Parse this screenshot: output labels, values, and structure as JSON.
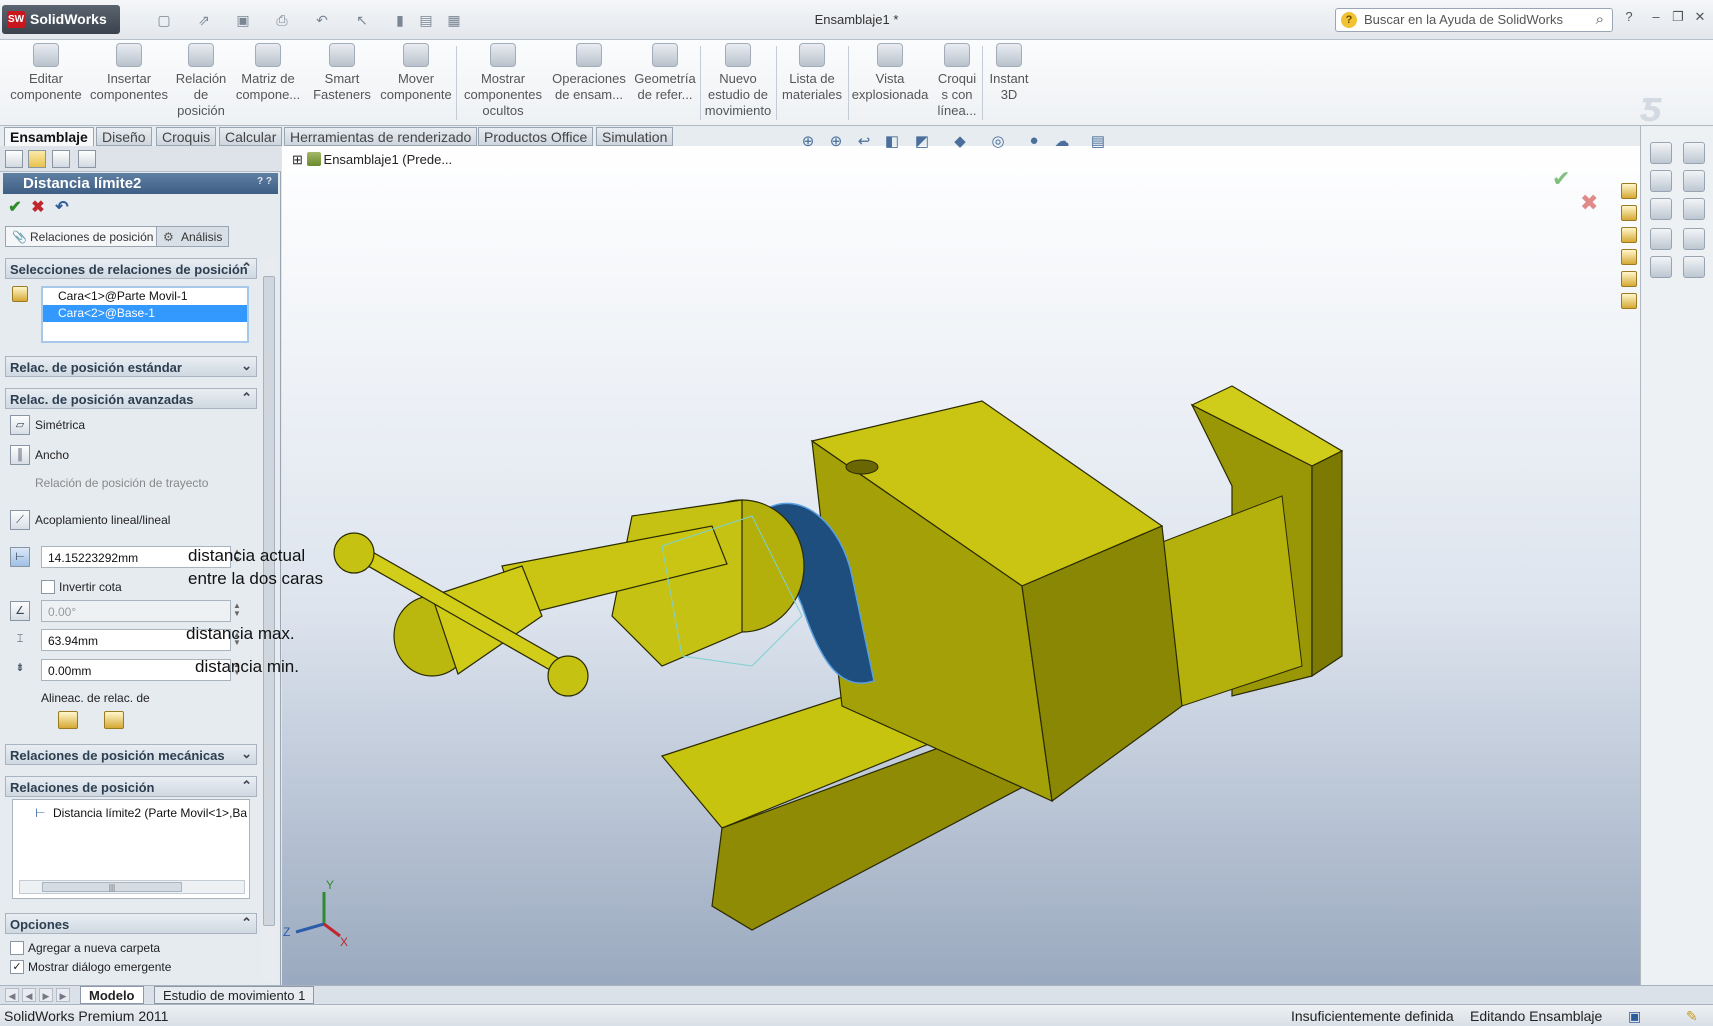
{
  "window": {
    "app_name": "SolidWorks",
    "doc_title": "Ensamblaje1 *",
    "help_placeholder": "Buscar en la Ayuda de SolidWorks",
    "help_q": "?",
    "min": "–",
    "restore": "❐",
    "close": "✕"
  },
  "ribbon": {
    "buttons": [
      "Editar\ncomponente",
      "Insertar\ncomponentes",
      "Relación\nde\nposición",
      "Matriz de\ncompone...",
      "Smart\nFasteners",
      "Mover\ncomponente",
      "Mostrar\ncomponentes\nocultos",
      "Operaciones\nde ensam...",
      "Geometría\nde refer...",
      "Nuevo\nestudio de\nmovimiento",
      "Lista de\nmateriales",
      "Vista\nexplosionada",
      "Croqui\ns con\nlínea...",
      "Instant\n3D"
    ]
  },
  "tabs": [
    "Ensamblaje",
    "Diseño",
    "Croquis",
    "Calcular",
    "Herramientas de renderizado",
    "Productos Office",
    "Simulation"
  ],
  "property_manager": {
    "title": "Distancia límite2",
    "tab_mates": "Relaciones de posición",
    "tab_analysis": "Análisis",
    "group_selections": "Selecciones de relaciones de posición",
    "selections": [
      "Cara<1>@Parte Movil-1",
      "Cara<2>@Base-1"
    ],
    "group_standard": "Relac. de posición estándar",
    "group_advanced": "Relac. de posición avanzadas",
    "adv": {
      "symmetric": "Simétrica",
      "width": "Ancho",
      "path": "Relación de posición de trayecto",
      "linear": "Acoplamiento lineal/lineal"
    },
    "distance_value": "14.15223292mm",
    "flip_dimension": "Invertir cota",
    "angle_value": "0.00°",
    "max_value": "63.94mm",
    "min_value": "0.00mm",
    "alignment_label": "Alineac. de relac. de",
    "group_mechanical": "Relaciones de posición mecánicas",
    "group_mates": "Relaciones de posición",
    "mate_entry": "Distancia límite2 (Parte Movil<1>,Ba",
    "group_options": "Opciones",
    "opt_new_folder": "Agregar a nueva carpeta",
    "opt_show_popup": "Mostrar diálogo emergente"
  },
  "viewport": {
    "tree_root": "Ensamblaje1  (Prede...",
    "annotations": {
      "current": "distancia actual\nentre la dos caras",
      "max": "distancia max.",
      "min": "distancia min."
    },
    "triad": {
      "x": "X",
      "y": "Y",
      "z": "Z"
    },
    "model_color": "#b8b400",
    "selected_face_color": "#1d4e7e"
  },
  "bottom_tabs": [
    "Modelo",
    "Estudio de movimiento 1"
  ],
  "status": {
    "product": "SolidWorks Premium 2011",
    "definition": "Insuficientemente definida",
    "mode": "Editando Ensamblaje"
  }
}
